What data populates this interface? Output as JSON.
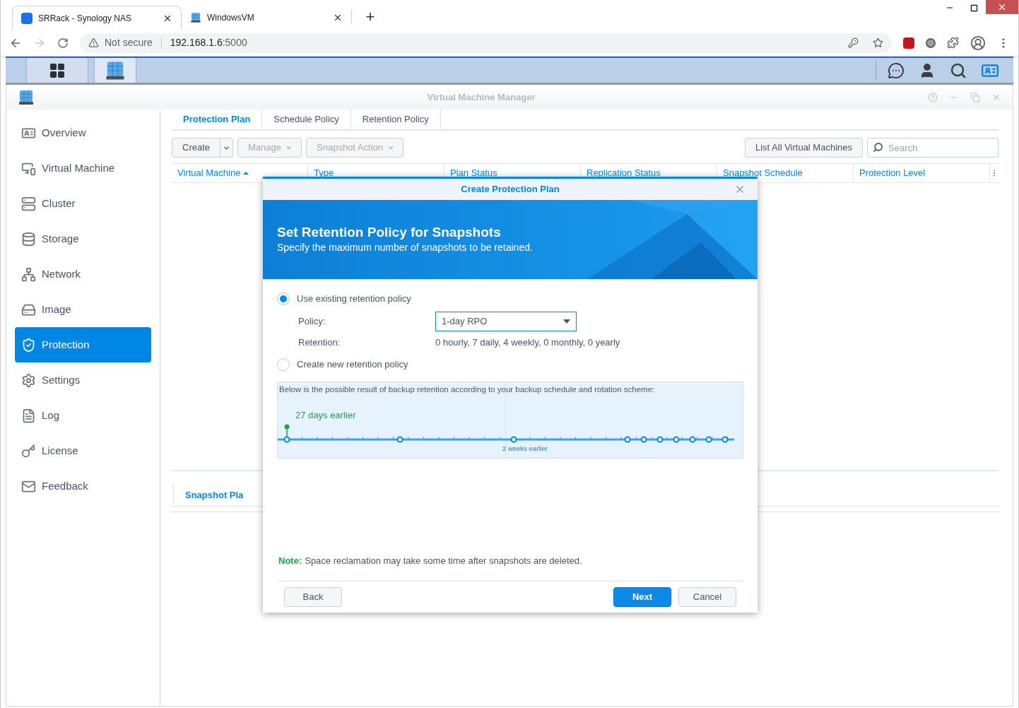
{
  "browser": {
    "tabs": [
      {
        "title": "SRRack - Synology NAS",
        "kind": "dsm",
        "selected": true
      },
      {
        "title": "WindowsVM",
        "kind": "vm",
        "selected": false
      }
    ],
    "new_tab": "+",
    "address": {
      "security": "Not secure",
      "host": "192.168.1.6",
      "port": ":5000"
    }
  },
  "taskbar": {
    "apps": [
      {
        "kind": "main_menu",
        "selected": false
      },
      {
        "kind": "vmm",
        "selected": true
      }
    ]
  },
  "window": {
    "title": "Virtual Machine Manager"
  },
  "sidebar": {
    "items": [
      {
        "label": "Overview",
        "kind": "overview",
        "selected": false
      },
      {
        "label": "Virtual Machine",
        "kind": "vm",
        "selected": false
      },
      {
        "label": "Cluster",
        "kind": "cluster",
        "selected": false
      },
      {
        "label": "Storage",
        "kind": "storage",
        "selected": false
      },
      {
        "label": "Network",
        "kind": "network",
        "selected": false
      },
      {
        "label": "Image",
        "kind": "image",
        "selected": false
      },
      {
        "label": "Protection",
        "kind": "protection",
        "selected": true
      },
      {
        "label": "Settings",
        "kind": "settings",
        "selected": false
      },
      {
        "label": "Log",
        "kind": "log",
        "selected": false
      },
      {
        "label": "License",
        "kind": "license",
        "selected": false
      },
      {
        "label": "Feedback",
        "kind": "feedback",
        "selected": false
      }
    ]
  },
  "tabs": [
    {
      "label": "Protection Plan",
      "selected": true
    },
    {
      "label": "Schedule Policy",
      "selected": false
    },
    {
      "label": "Retention Policy",
      "selected": false
    }
  ],
  "toolbar": {
    "buttons": [
      {
        "label": "Create",
        "kind": "split",
        "disabled": false
      },
      {
        "label": "Manage",
        "kind": "menu",
        "disabled": true
      },
      {
        "label": "Snapshot Action",
        "kind": "menu",
        "disabled": true
      }
    ],
    "list_all": "List All Virtual Machines",
    "search": {
      "placeholder": "Search"
    }
  },
  "table": {
    "columns": [
      {
        "label": "Virtual Machine",
        "sorted": true
      },
      {
        "label": "Type",
        "sorted": false
      },
      {
        "label": "Plan Status",
        "sorted": false
      },
      {
        "label": "Replication Status",
        "sorted": false
      },
      {
        "label": "Snapshot Schedule",
        "sorted": false
      },
      {
        "label": "Protection Level",
        "sorted": false
      }
    ]
  },
  "lower_tabs": [
    {
      "label": "Snapshot Pla",
      "selected": true
    }
  ],
  "dialog": {
    "title": "Create Protection Plan",
    "heading": "Set Retention Policy for Snapshots",
    "subheading": "Specify the maximum number of snapshots to be retained.",
    "options": [
      {
        "label": "Use existing retention policy",
        "selected": true
      },
      {
        "label": "Create new retention policy",
        "selected": false
      }
    ],
    "policy": {
      "label": "Policy:",
      "value": "1-day RPO"
    },
    "retention": {
      "label": "Retention:",
      "value": "0 hourly, 7 daily, 4 weekly, 0 monthly, 0 yearly"
    },
    "preview": {
      "caption": "Below is the possible result of backup retention according to your backup schedule and rotation scheme:",
      "oldest": "27 days earlier",
      "mid": "2 weeks earlier"
    },
    "note": {
      "label": "Note:",
      "text": "Space reclamation may take some time after snapshots are deleted."
    },
    "buttons": [
      {
        "label": "Back",
        "kind": "secondary"
      },
      {
        "label": "Next",
        "kind": "primary"
      },
      {
        "label": "Cancel",
        "kind": "secondary"
      }
    ]
  }
}
